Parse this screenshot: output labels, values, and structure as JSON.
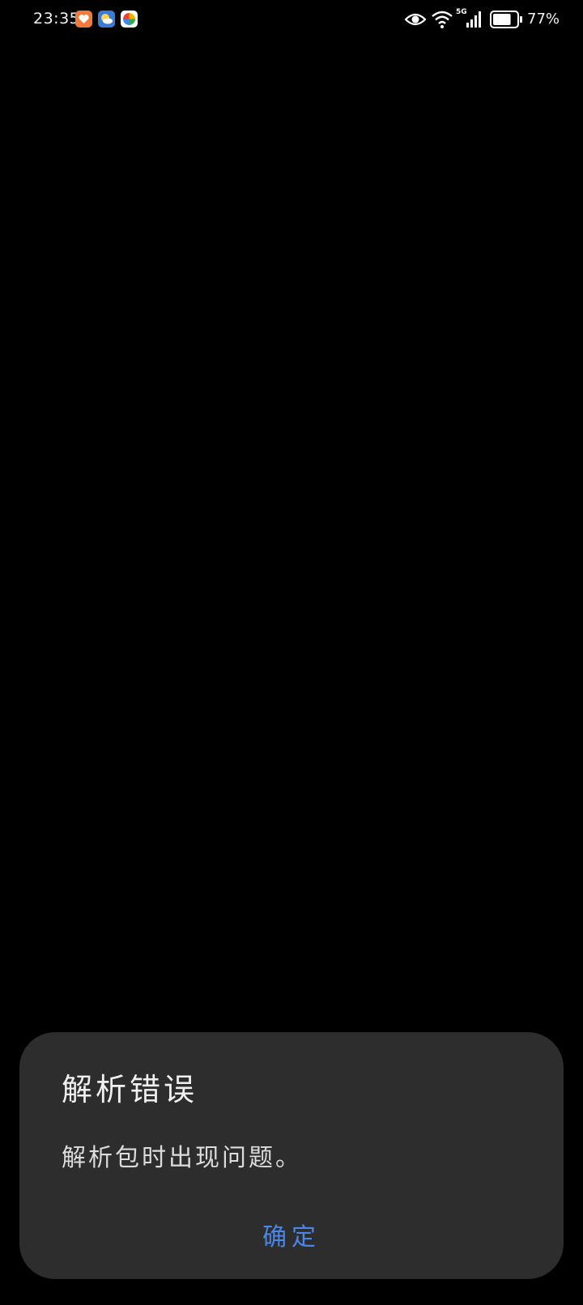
{
  "status_bar": {
    "time": "23:35",
    "network": "5G",
    "battery_percent": "77%",
    "battery_level": 0.77,
    "notification_icons": [
      "health-app-icon",
      "weather-app-icon",
      "pinwheel-app-icon"
    ],
    "status_icons": [
      "eye-comfort-icon",
      "wifi-icon",
      "cellular-signal-icon",
      "battery-icon"
    ]
  },
  "dialog": {
    "title": "解析错误",
    "message": "解析包时出现问题。",
    "confirm_label": "确定",
    "accent_color": "#4a86e8",
    "background_color": "#2d2d2d"
  }
}
